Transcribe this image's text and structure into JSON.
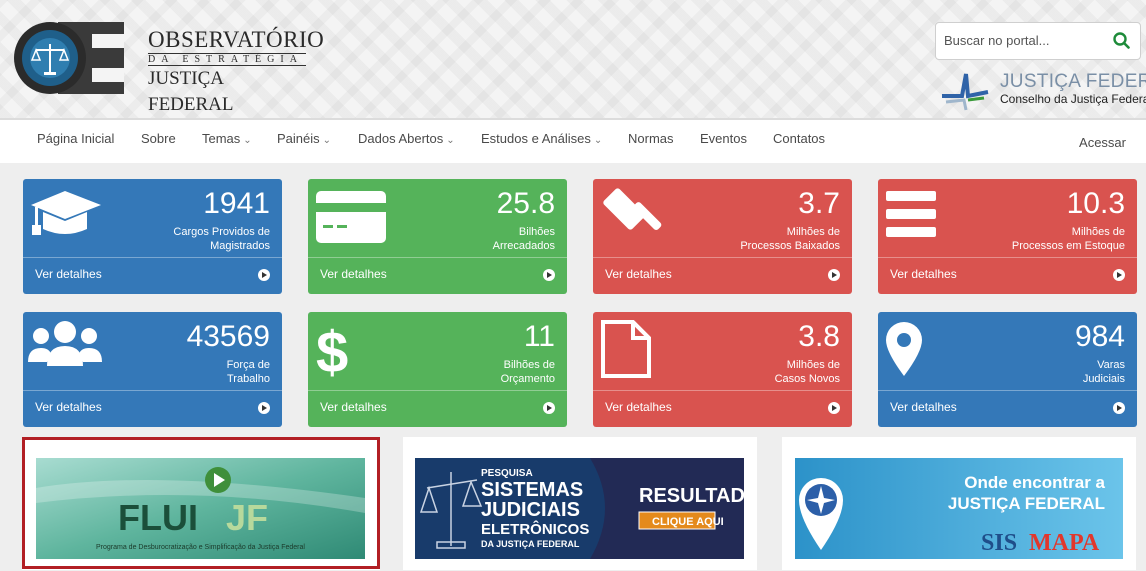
{
  "header": {
    "logo": {
      "line1": "OBSERVATÓRIO",
      "line2": "DA ESTRATÉGIA",
      "line3": "JUSTIÇA FEDERAL"
    },
    "search": {
      "placeholder": "Buscar no portal..."
    },
    "jf": {
      "title": "JUSTIÇA FEDERAL",
      "subtitle": "Conselho da Justiça Federal"
    }
  },
  "nav": {
    "items": [
      {
        "label": "Página Inicial",
        "dropdown": false
      },
      {
        "label": "Sobre",
        "dropdown": false
      },
      {
        "label": "Temas",
        "dropdown": true
      },
      {
        "label": "Painéis",
        "dropdown": true
      },
      {
        "label": "Dados Abertos",
        "dropdown": true
      },
      {
        "label": "Estudos e Análises",
        "dropdown": true
      },
      {
        "label": "Normas",
        "dropdown": false
      },
      {
        "label": "Eventos",
        "dropdown": false
      },
      {
        "label": "Contatos",
        "dropdown": false
      }
    ],
    "caret": "⌄",
    "login": "Acessar"
  },
  "cards": [
    {
      "value": "1941",
      "label_line1": "Cargos Providos de",
      "label_line2": "Magistrados",
      "link": "Ver detalhes",
      "color": "#3478b8",
      "icon": "graduation-cap-icon"
    },
    {
      "value": "25.8",
      "label_line1": "Bilhões",
      "label_line2": "Arrecadados",
      "link": "Ver detalhes",
      "color": "#55b35a",
      "icon": "credit-card-icon"
    },
    {
      "value": "3.7",
      "label_line1": "Milhões de",
      "label_line2": "Processos Baixados",
      "link": "Ver detalhes",
      "color": "#d9534f",
      "icon": "gavel-icon"
    },
    {
      "value": "10.3",
      "label_line1": "Milhões de",
      "label_line2": "Processos em Estoque",
      "link": "Ver detalhes",
      "color": "#d9534f",
      "icon": "list-icon"
    },
    {
      "value": "43569",
      "label_line1": "Força de",
      "label_line2": "Trabalho",
      "link": "Ver detalhes",
      "color": "#3478b8",
      "icon": "users-icon"
    },
    {
      "value": "11",
      "label_line1": "Bilhões de",
      "label_line2": "Orçamento",
      "link": "Ver detalhes",
      "color": "#55b35a",
      "icon": "dollar-icon"
    },
    {
      "value": "3.8",
      "label_line1": "Milhões de",
      "label_line2": "Casos Novos",
      "link": "Ver detalhes",
      "color": "#d9534f",
      "icon": "document-icon"
    },
    {
      "value": "984",
      "label_line1": "Varas",
      "label_line2": "Judiciais",
      "link": "Ver detalhes",
      "color": "#3478b8",
      "icon": "map-marker-icon"
    }
  ],
  "banners": {
    "fluijf": {
      "brand_a": "FLUI",
      "brand_b": "JF",
      "caption": "Programa de Desburocratização e Simplificação da Justiça Federal"
    },
    "pesquisa": {
      "kicker": "PESQUISA",
      "line1": "SISTEMAS",
      "line2": "JUDICIAIS",
      "line3": "ELETRÔNICOS",
      "line4": "DA JUSTIÇA FEDERAL",
      "result": "RESULTADO",
      "cta": "CLIQUE AQUI"
    },
    "sismapa": {
      "line1": "Onde encontrar a",
      "line2": "JUSTIÇA FEDERAL",
      "brand_a": "SIS",
      "brand_b": "MAPA"
    }
  }
}
